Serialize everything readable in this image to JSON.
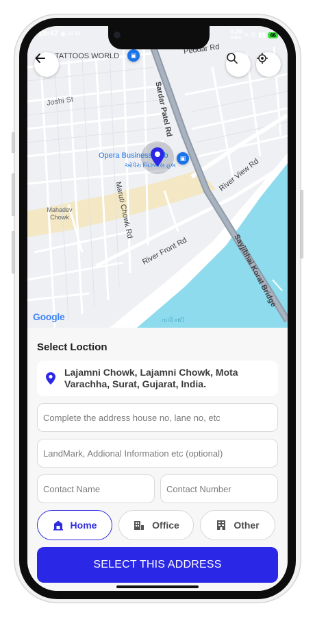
{
  "status_bar": {
    "time": "10:47",
    "speed": "0.25",
    "speed_unit": "KB/S",
    "battery": "46"
  },
  "map": {
    "labels": {
      "tattoos": "TATTOOS WORLD",
      "peddar": "Peddar Rd",
      "joshi": "Joshi St",
      "sardar": "Sardar Patel Rd",
      "opera": "Opera Business Hub",
      "opera_gujarati": "ઓપેરા બિઝનેસ હબ",
      "river_view": "River View Rd",
      "maruti": "Maruti Chowk Rd",
      "mahadev": "Mahadev Chowk",
      "river_front": "River Front Rd",
      "bridge": "Sayjibhai Korat Bridge",
      "tapi": "તાપી નદી",
      "google": "Google"
    },
    "colors": {
      "water": "#8ddbed",
      "road_major": "#8e9aa8",
      "highlight": "#f3e7c4"
    }
  },
  "sheet": {
    "title": "Select Loction",
    "selected_address": "Lajamni Chowk, Lajamni Chowk, Mota Varachha, Surat, Gujarat, India.",
    "fields": {
      "address_placeholder": "Complete the address house no, lane no, etc",
      "landmark_placeholder": "LandMark, Addional Information etc (optional)",
      "contact_name_placeholder": "Contact Name",
      "contact_number_placeholder": "Contact Number"
    },
    "address_types": [
      {
        "label": "Home",
        "icon": "home-icon",
        "selected": true
      },
      {
        "label": "Office",
        "icon": "office-icon",
        "selected": false
      },
      {
        "label": "Other",
        "icon": "building-icon",
        "selected": false
      }
    ],
    "submit_label": "SELECT THIS ADDRESS",
    "accent_color": "#2b27e6"
  }
}
